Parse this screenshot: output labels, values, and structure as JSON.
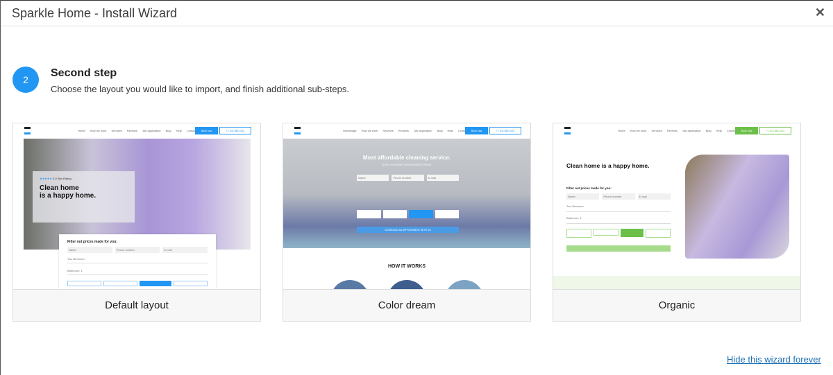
{
  "window": {
    "title": "Sparkle Home - Install Wizard",
    "close_icon": "close-icon"
  },
  "step": {
    "number": "2",
    "title": "Second step",
    "subtitle": "Choose the layout you would like to import, and finish additional sub-steps.",
    "accent": "#2196f3"
  },
  "layouts": [
    {
      "label": "Default layout",
      "accent": "#2196f3",
      "nav": [
        "Home",
        "How we work",
        "Services",
        "Reviews",
        "Job application",
        "Blog",
        "Help",
        "Contact"
      ],
      "book": "Book now",
      "phone": "+1 202-555-0131",
      "rating": "5.0 Star Rating",
      "headline1": "Clean home",
      "headline2": "is a happy home.",
      "filter": "Filter out prices made for you:",
      "fields": [
        "Name",
        "Phone number",
        "E-mail"
      ],
      "slider1": "Two Bedroom",
      "slider2": "Bathroom: 1"
    },
    {
      "label": "Color dream",
      "accent": "#2196f3",
      "nav": [
        "Homepage",
        "How we work",
        "Services",
        "Reviews",
        "Job application",
        "Blog",
        "Help",
        "Contact"
      ],
      "book": "Book now",
      "phone": "+1 202-555-0131",
      "headline": "Most affordable cleaning service.",
      "sub": "Book a trusted maid instantly below.",
      "fields": [
        "Name",
        "Phone number",
        "E-mail"
      ],
      "cta": "SCHEDULE AN APPOINTMENT WITH US",
      "section": "HOW IT WORKS"
    },
    {
      "label": "Organic",
      "accent": "#6cc04a",
      "nav": [
        "Home",
        "How we work",
        "Services",
        "Reviews",
        "Job application",
        "Blog",
        "Help",
        "Contact"
      ],
      "book": "Book now",
      "phone": "+1 202-555-0131",
      "headline": "Clean home is a happy home.",
      "filter": "Filter out prices made for you:",
      "fields": [
        "Name",
        "Phone number",
        "E-mail"
      ],
      "slider1": "Two Bedroom",
      "slider2": "Bathroom: 1"
    }
  ],
  "footer": {
    "hide_link": "Hide this wizard forever"
  }
}
